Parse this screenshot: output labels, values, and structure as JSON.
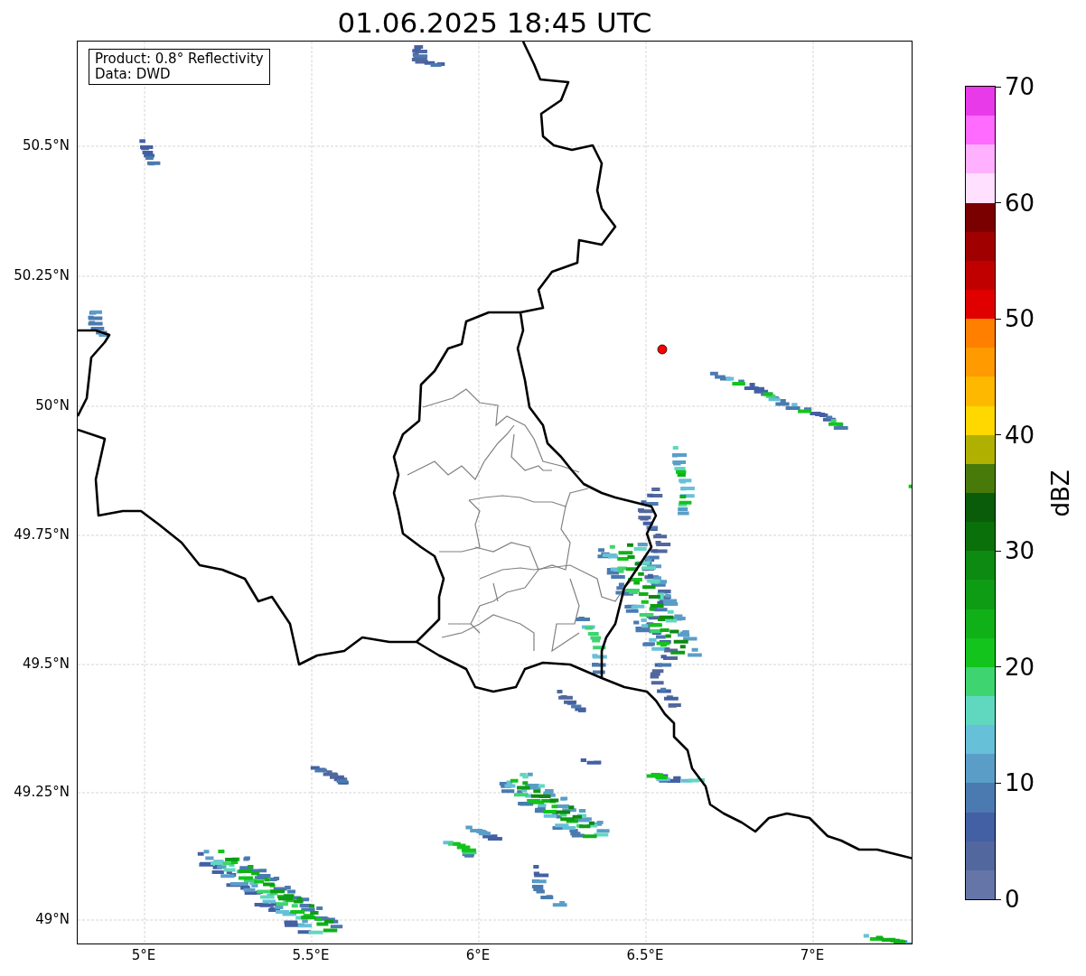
{
  "title": "01.06.2025 18:45 UTC",
  "map": {
    "info_box": [
      "Product: 0.8° Reflectivity",
      "Data: DWD"
    ],
    "xticks": [
      "5°E",
      "5.5°E",
      "6°E",
      "6.5°E",
      "7°E"
    ],
    "yticks": [
      "50.5°N",
      "50.25°N",
      "50°N",
      "49.75°N",
      "49.5°N",
      "49.25°N",
      "49°N"
    ]
  },
  "colorbar": {
    "label": "dBZ",
    "ticks": [
      "70",
      "60",
      "50",
      "40",
      "30",
      "20",
      "10",
      "0"
    ],
    "bands": [
      {
        "color": "#6575a8"
      },
      {
        "color": "#52679e"
      },
      {
        "color": "#4460a4"
      },
      {
        "color": "#4a7ab0"
      },
      {
        "color": "#5a9ec8"
      },
      {
        "color": "#66c0d8"
      },
      {
        "color": "#60d8c0"
      },
      {
        "color": "#3ed470"
      },
      {
        "color": "#12c41c"
      },
      {
        "color": "#10b018"
      },
      {
        "color": "#0e9c14"
      },
      {
        "color": "#0c8a12"
      },
      {
        "color": "#0a700a"
      },
      {
        "color": "#0a5c0a"
      },
      {
        "color": "#487a0a"
      },
      {
        "color": "#b0b000"
      },
      {
        "color": "#ffd800"
      },
      {
        "color": "#ffb800"
      },
      {
        "color": "#ff9a00"
      },
      {
        "color": "#ff7f00"
      },
      {
        "color": "#e00000"
      },
      {
        "color": "#c00000"
      },
      {
        "color": "#a00000"
      },
      {
        "color": "#7a0000"
      },
      {
        "color": "#ffe0ff"
      },
      {
        "color": "#ffb0ff"
      },
      {
        "color": "#ff6aff"
      },
      {
        "color": "#e83ae8"
      }
    ]
  }
}
